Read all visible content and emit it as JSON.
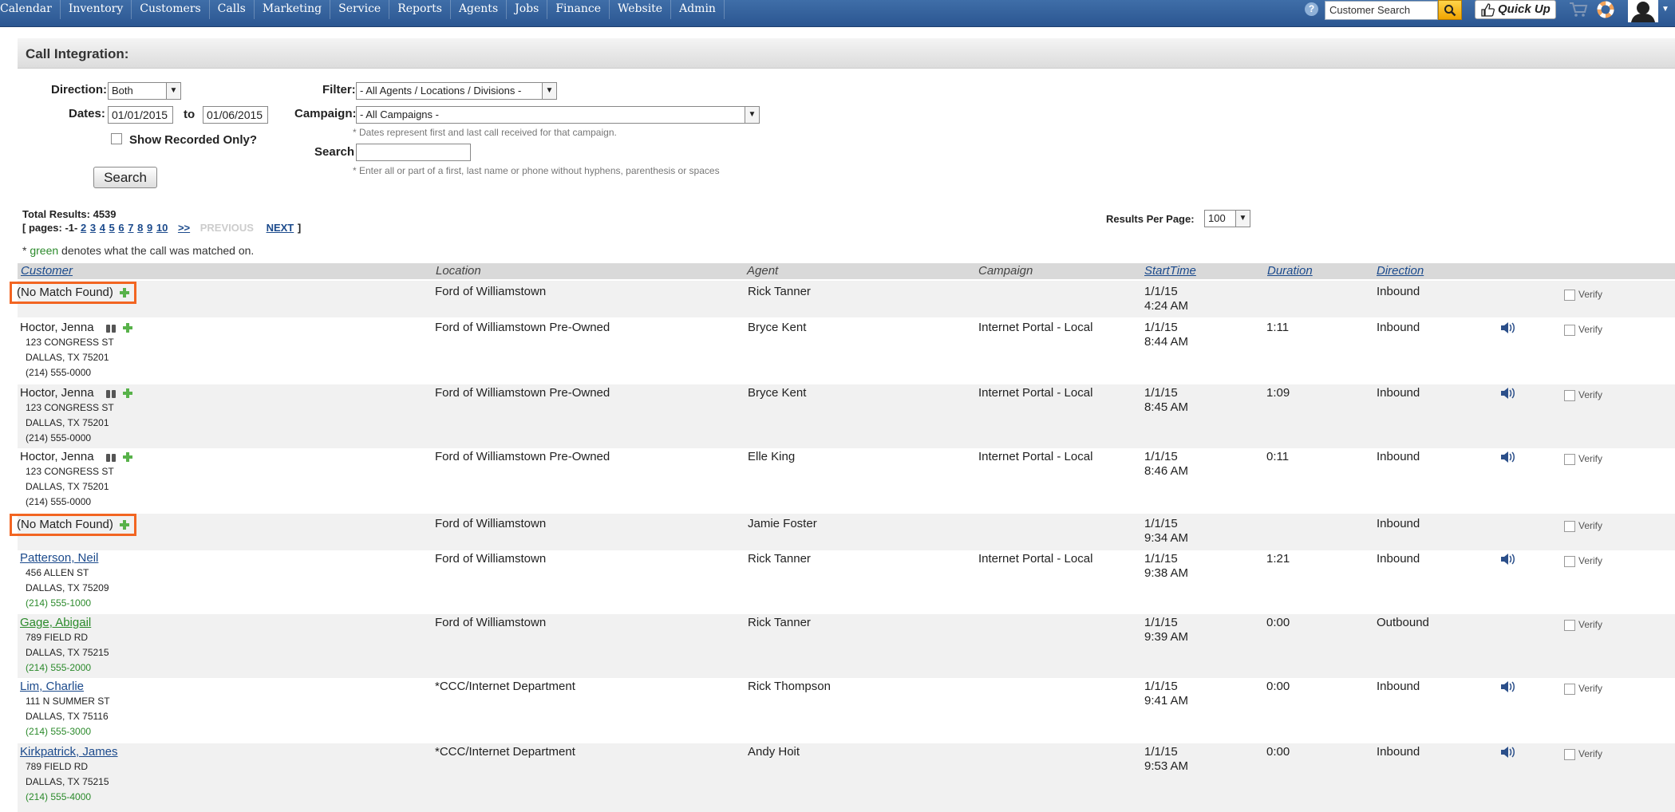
{
  "nav": {
    "items": [
      "Calendar",
      "Inventory",
      "Customers",
      "Calls",
      "Marketing",
      "Service",
      "Reports",
      "Agents",
      "Jobs",
      "Finance",
      "Website",
      "Admin"
    ],
    "search_placeholder": "Customer Search",
    "quickup_label": "Quick Up"
  },
  "panel": {
    "title": "Call Integration:"
  },
  "filters": {
    "direction_label": "Direction:",
    "direction_value": "Both",
    "dates_label": "Dates:",
    "date_from": "01/01/2015",
    "date_to_label": "to",
    "date_to": "01/06/2015",
    "show_recorded_label": "Show Recorded Only?",
    "filter_label": "Filter:",
    "filter_value": "- All Agents / Locations / Divisions -",
    "campaign_label": "Campaign:",
    "campaign_value": "- All Campaigns -",
    "campaign_hint": "* Dates represent first and last call received for that campaign.",
    "search_label": "Search",
    "search_hint": "* Enter all or part of a first, last name or phone without hyphens, parenthesis or spaces",
    "search_button": "Search"
  },
  "results": {
    "total_label": "Total Results: 4539",
    "pages_prefix": "[ pages: -1-",
    "pages": [
      "2",
      "3",
      "4",
      "5",
      "6",
      "7",
      "8",
      "9",
      "10"
    ],
    "more": ">>",
    "previous": "PREVIOUS",
    "next": "NEXT",
    "pages_suffix": "]",
    "per_page_label": "Results Per Page:",
    "per_page_value": "100",
    "note_prefix": "*",
    "note_green": "green",
    "note_suffix": "denotes what the call was matched on."
  },
  "table": {
    "headers": {
      "customer": "Customer",
      "location": "Location",
      "agent": "Agent",
      "campaign": "Campaign",
      "starttime": "StartTime",
      "duration": "Duration",
      "direction": "Direction"
    },
    "verify_label": "Verify",
    "rows": [
      {
        "customer": "(No Match Found)",
        "location": "Ford of Williamstown",
        "agent": "Rick Tanner",
        "campaign": "",
        "date": "1/1/15",
        "time": "4:24 AM",
        "duration": "",
        "direction": "Inbound"
      },
      {
        "customer": "Hoctor, Jenna",
        "street": "123 CONGRESS ST",
        "city": "DALLAS, TX 75201",
        "phone": "(214) 555-0000",
        "location": "Ford of Williamstown Pre-Owned",
        "agent": "Bryce Kent",
        "campaign": "Internet Portal - Local",
        "date": "1/1/15",
        "time": "8:44 AM",
        "duration": "1:11",
        "direction": "Inbound"
      },
      {
        "customer": "Hoctor, Jenna",
        "street": "123 CONGRESS ST",
        "city": "DALLAS, TX 75201",
        "phone": "(214) 555-0000",
        "location": "Ford of Williamstown Pre-Owned",
        "agent": "Bryce Kent",
        "campaign": "Internet Portal - Local",
        "date": "1/1/15",
        "time": "8:45 AM",
        "duration": "1:09",
        "direction": "Inbound"
      },
      {
        "customer": "Hoctor, Jenna",
        "street": "123 CONGRESS ST",
        "city": "DALLAS, TX 75201",
        "phone": "(214) 555-0000",
        "location": "Ford of Williamstown Pre-Owned",
        "agent": "Elle King",
        "campaign": "Internet Portal - Local",
        "date": "1/1/15",
        "time": "8:46 AM",
        "duration": "0:11",
        "direction": "Inbound"
      },
      {
        "customer": "(No Match Found)",
        "location": "Ford of Williamstown",
        "agent": "Jamie Foster",
        "campaign": "",
        "date": "1/1/15",
        "time": "9:34 AM",
        "duration": "",
        "direction": "Inbound"
      },
      {
        "customer": "Patterson, Neil",
        "street": "456 ALLEN ST",
        "city": "DALLAS, TX 75209",
        "phone": "(214) 555-1000",
        "location": "Ford of Williamstown",
        "agent": "Rick Tanner",
        "campaign": "Internet Portal - Local",
        "date": "1/1/15",
        "time": "9:38 AM",
        "duration": "1:21",
        "direction": "Inbound"
      },
      {
        "customer": "Gage, Abigail",
        "street": "789 FIELD RD",
        "city": "DALLAS, TX 75215",
        "phone": "(214) 555-2000",
        "location": "Ford of Williamstown",
        "agent": "Rick Tanner",
        "campaign": "",
        "date": "1/1/15",
        "time": "9:39 AM",
        "duration": "0:00",
        "direction": "Outbound"
      },
      {
        "customer": "Lim, Charlie",
        "street": "111 N SUMMER ST",
        "city": "DALLAS, TX 75116",
        "phone": "(214) 555-3000",
        "location": "*CCC/Internet Department",
        "agent": "Rick Thompson",
        "campaign": "",
        "date": "1/1/15",
        "time": "9:41 AM",
        "duration": "0:00",
        "direction": "Inbound"
      },
      {
        "customer": "Kirkpatrick, James",
        "street": "789 FIELD RD",
        "city": "DALLAS, TX 75215",
        "phone": "(214) 555-4000",
        "location": "*CCC/Internet Department",
        "agent": "Andy Hoit",
        "campaign": "",
        "date": "1/1/15",
        "time": "9:53 AM",
        "duration": "0:00",
        "direction": "Inbound"
      }
    ]
  },
  "colors": {
    "nav": "#2b5691",
    "highlight": "#f26522",
    "match_green": "#2b8a2b",
    "link": "#1b4a8c"
  }
}
